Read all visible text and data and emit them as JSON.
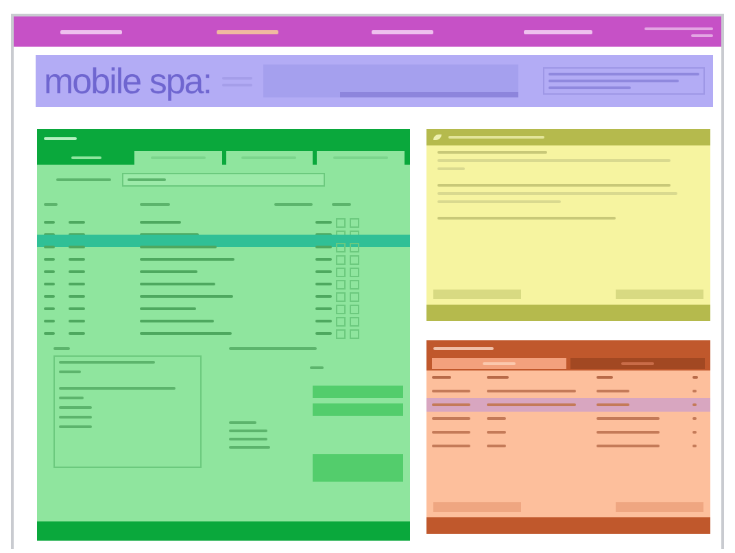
{
  "nav": {
    "items": [
      {
        "selected": false
      },
      {
        "selected": true
      },
      {
        "selected": false
      },
      {
        "selected": false
      }
    ]
  },
  "header": {
    "logo": "mobile spa:"
  },
  "list_panel": {
    "tabs": [
      {
        "selected": true
      },
      {
        "selected": false
      },
      {
        "selected": false
      },
      {
        "selected": false
      }
    ],
    "rows": [
      {
        "selected": false
      },
      {
        "selected": false
      },
      {
        "selected": true
      },
      {
        "selected": false
      },
      {
        "selected": false
      },
      {
        "selected": false
      },
      {
        "selected": false
      },
      {
        "selected": false
      },
      {
        "selected": false
      },
      {
        "selected": false
      }
    ]
  },
  "log_panel": {
    "tabs": [
      {
        "selected": true
      },
      {
        "selected": false
      }
    ],
    "rows": [
      {
        "selected": false
      },
      {
        "selected": true
      },
      {
        "selected": false
      },
      {
        "selected": false
      },
      {
        "selected": false
      }
    ]
  }
}
